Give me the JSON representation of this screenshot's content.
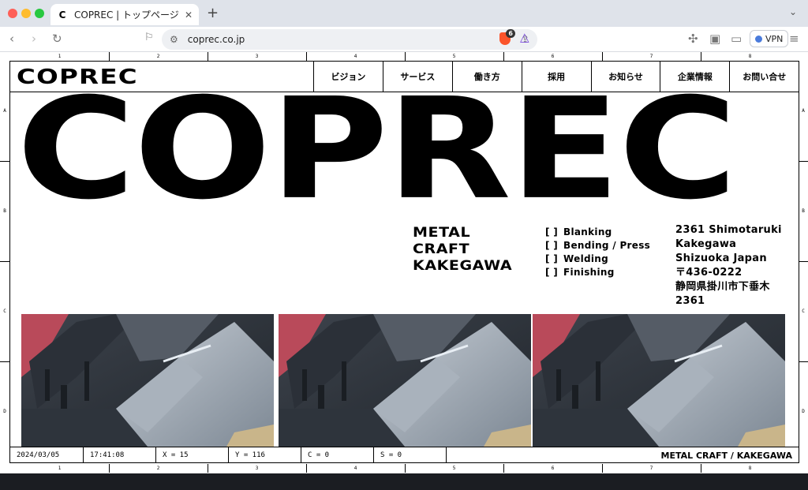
{
  "browser": {
    "tab_title": "COPREC | トップページ",
    "tab_favicon": "C",
    "url": "coprec.co.jp",
    "shields_count": "6",
    "vpn_label": "VPN"
  },
  "site": {
    "logo": "COPREC",
    "nav": [
      "ビジョン",
      "サービス",
      "働き方",
      "採用",
      "お知らせ",
      "企業情報",
      "お問い合せ"
    ],
    "hero": "COPREC",
    "tagline": [
      "METAL",
      "CRAFT",
      "KAKEGAWA"
    ],
    "services": [
      "Blanking",
      "Bending / Press",
      "Welding",
      "Finishing"
    ],
    "service_bracket": "[ ]",
    "address": [
      "2361 Shimotaruki",
      "Kakegawa",
      "Shizuoka Japan",
      "〒436-0222",
      "静岡県掛川市下垂木2361"
    ]
  },
  "ruler": {
    "columns": [
      "1",
      "2",
      "3",
      "4",
      "5",
      "6",
      "7",
      "8"
    ],
    "rows": [
      "A",
      "B",
      "C",
      "D"
    ]
  },
  "status": {
    "date": "2024/03/05",
    "time": "17:41:08",
    "x": "X = 15",
    "y": "Y = 116",
    "c": "C = 0",
    "s": "S = 0",
    "right": "METAL CRAFT / KAKEGAWA"
  },
  "colors": {
    "accent_brave": "#fb542b",
    "ink": "#000000"
  }
}
